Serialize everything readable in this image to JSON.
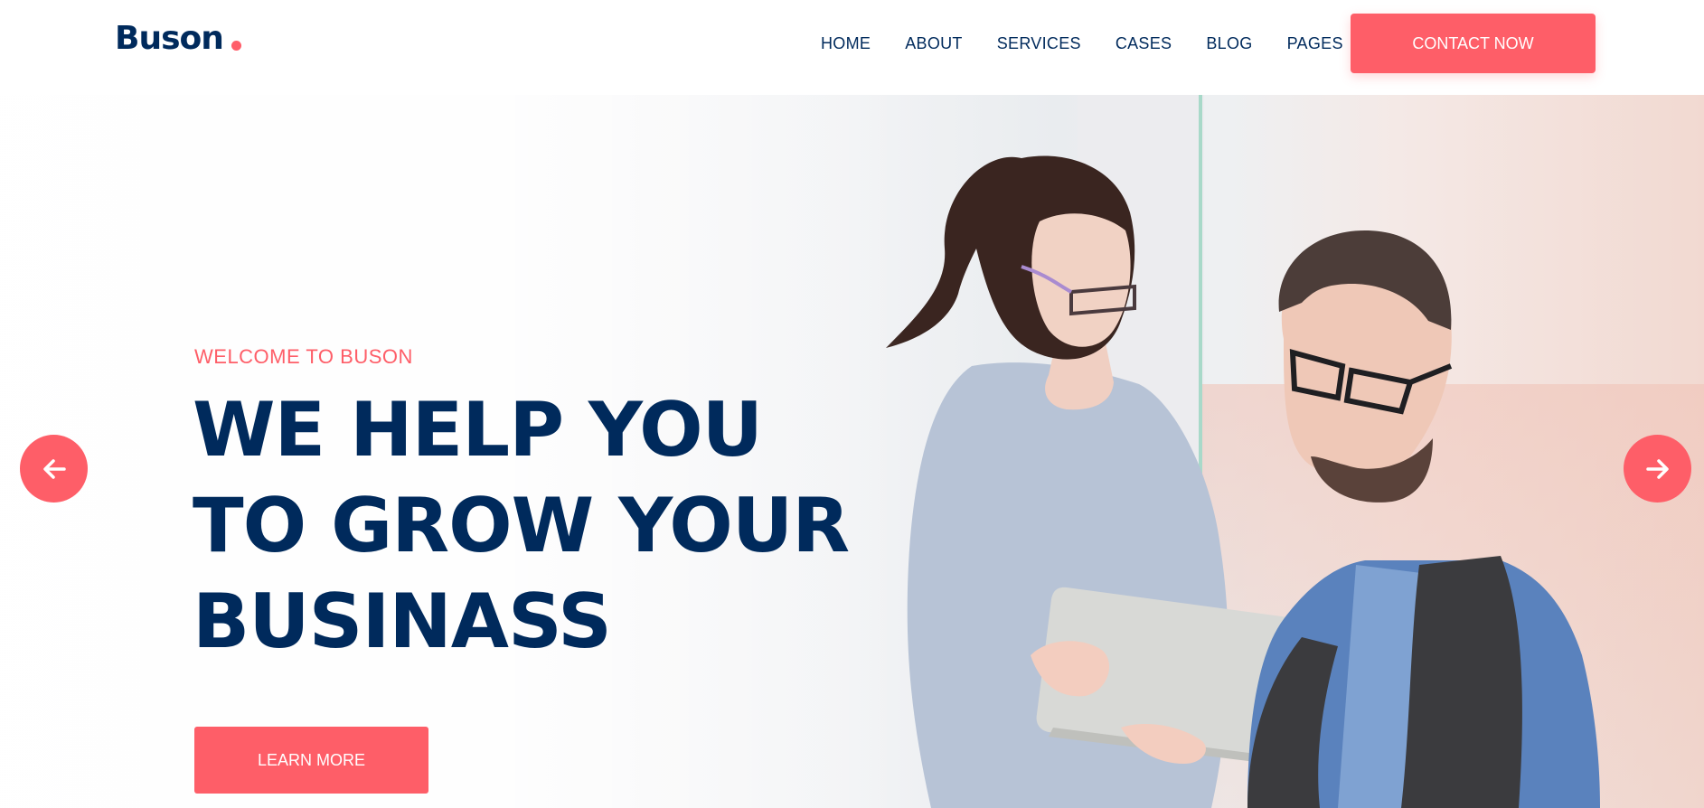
{
  "header": {
    "logo": "Buson",
    "nav": [
      "HOME",
      "ABOUT",
      "SERVICES",
      "CASES",
      "BLOG",
      "PAGES"
    ],
    "contact_button": "CONTACT NOW"
  },
  "hero": {
    "welcome": "WELCOME TO BUSON",
    "headline_lines": [
      "WE HELP YOU",
      "TO GROW YOUR",
      "BUSINASS"
    ],
    "cta_button": "LEARN MORE",
    "prev_icon": "arrow-left-icon",
    "next_icon": "arrow-right-icon",
    "image": "photo-of-two-business-people-with-tablet"
  },
  "colors": {
    "accent": "#fe5e68",
    "navy": "#002a5c"
  }
}
